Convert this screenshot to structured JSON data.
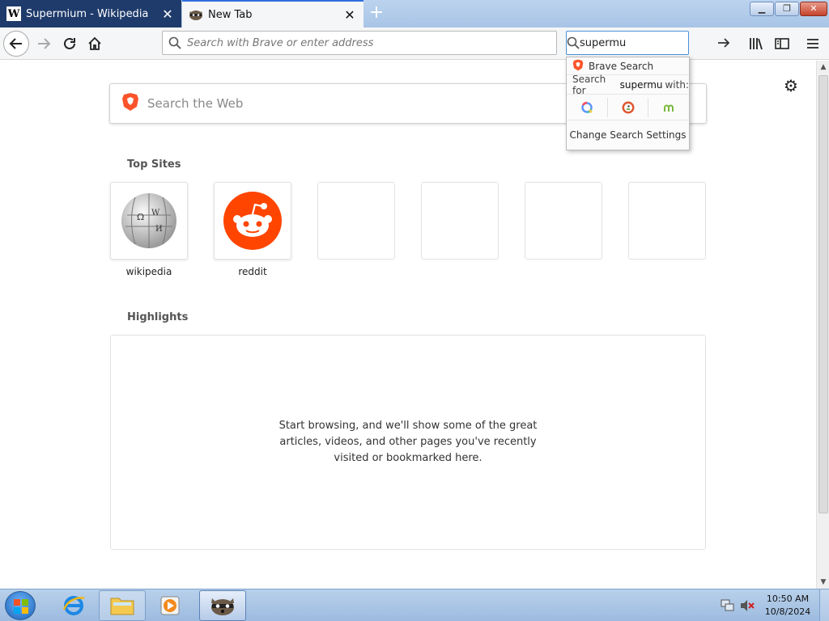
{
  "tabs": [
    {
      "title": "Supermium - Wikipedia",
      "favicon": "wikipedia-icon",
      "active": false,
      "favicon_letter": "W"
    },
    {
      "title": "New Tab",
      "favicon": "raccoon-icon",
      "active": true
    }
  ],
  "toolbar": {
    "url_placeholder": "Search with Brave or enter address",
    "search_value": "supermu"
  },
  "content": {
    "web_search_placeholder": "Search the Web",
    "top_sites_title": "Top Sites",
    "top_sites": [
      {
        "label": "wikipedia",
        "icon": "wikipedia-globe-icon"
      },
      {
        "label": "reddit",
        "icon": "reddit-icon"
      },
      {
        "label": ""
      },
      {
        "label": ""
      },
      {
        "label": ""
      },
      {
        "label": ""
      }
    ],
    "highlights_title": "Highlights",
    "highlights_message": "Start browsing, and we'll show some of the great articles, videos, and other pages you've recently visited or bookmarked here."
  },
  "dropdown": {
    "engine_name": "Brave Search",
    "search_for_prefix": "Search for",
    "search_for_term": "supermu",
    "search_for_suffix": "with:",
    "engines": [
      "qwant-icon",
      "duckduckgo-icon",
      "mojeek-icon"
    ],
    "settings_label": "Change Search Settings"
  },
  "taskbar": {
    "time": "10:50 AM",
    "date": "10/8/2024"
  },
  "colors": {
    "accent": "#2f6fe0",
    "reddit": "#ff4500",
    "brave": "#fb542b",
    "tab_inactive": "#1f3b6b"
  }
}
